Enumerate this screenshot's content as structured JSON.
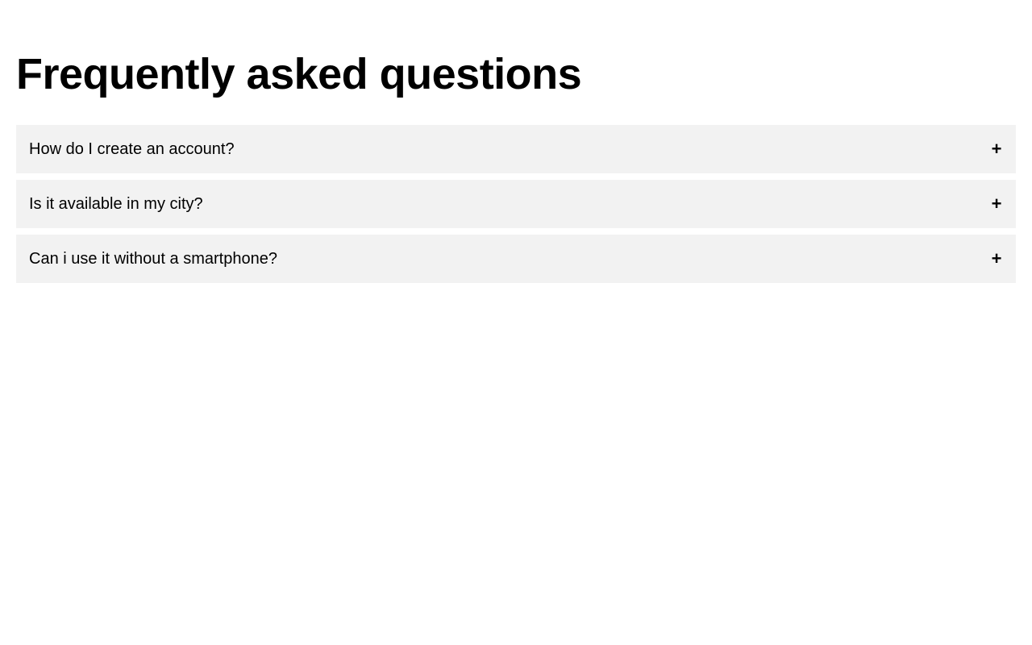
{
  "page": {
    "title": "Frequently asked questions"
  },
  "faq": {
    "items": [
      {
        "question": "How do I create an account?",
        "toggle_icon": "+"
      },
      {
        "question": "Is it available in my city?",
        "toggle_icon": "+"
      },
      {
        "question": "Can i use it without a smartphone?",
        "toggle_icon": "+"
      }
    ]
  },
  "colors": {
    "background": "#ffffff",
    "item_background": "#f2f2f2",
    "text": "#000000"
  },
  "icons": {
    "toggle": "plus-icon"
  }
}
